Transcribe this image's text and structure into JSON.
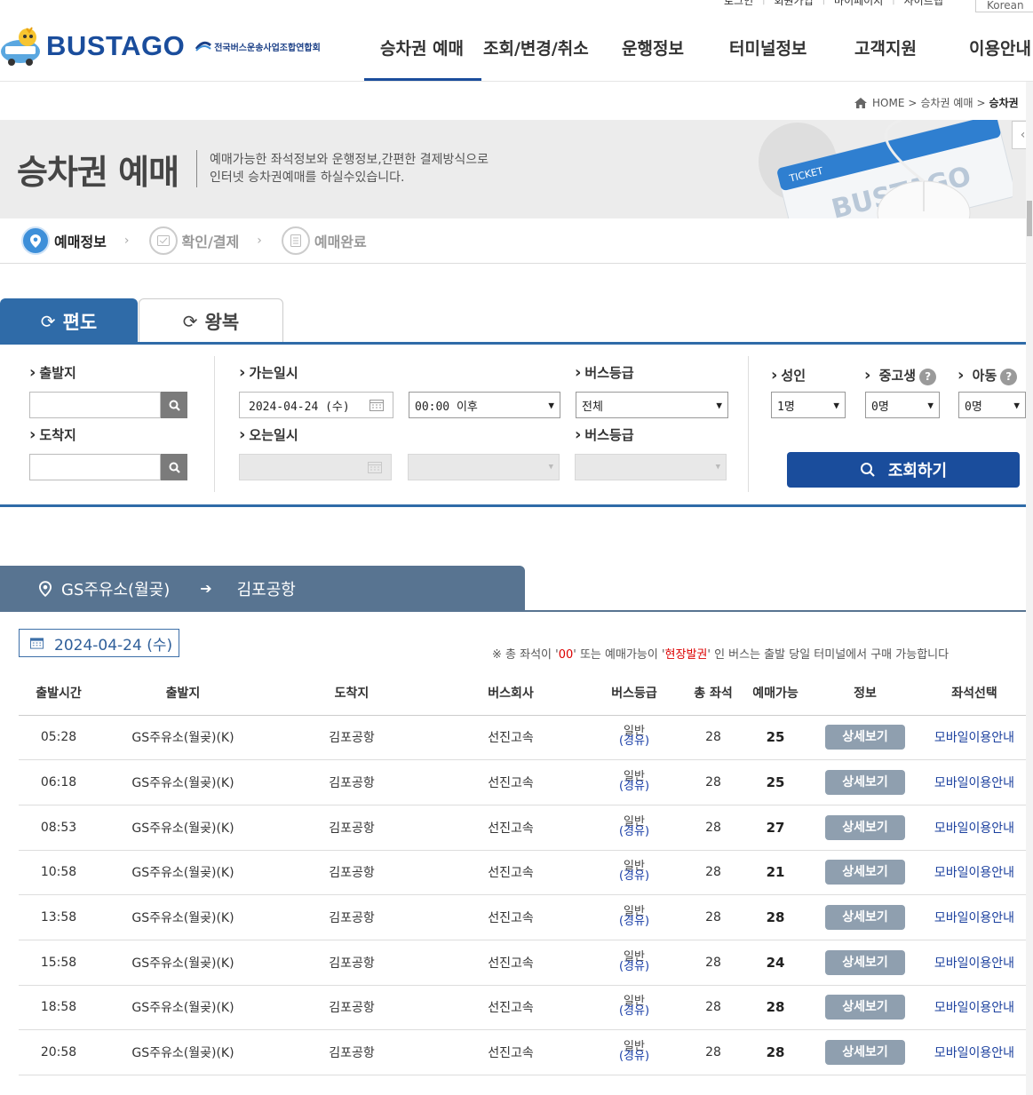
{
  "util": {
    "login": "로그인",
    "join": "회원가입",
    "mypage": "마이페이지",
    "sitemap": "사이트맵",
    "lang": "Korean"
  },
  "header": {
    "brand": "BUSTAGO",
    "assoc": "전국버스운송사업조합연합회",
    "nav": [
      "승차권 예매",
      "조회/변경/취소",
      "운행정보",
      "터미널정보",
      "고객지원",
      "이용안내"
    ]
  },
  "breadcrumb": {
    "home": "HOME",
    "section": "승차권 예매",
    "current": "승차권"
  },
  "banner": {
    "title": "승차권 예매",
    "desc1": "예매가능한 좌석정보와 운행정보,간편한 결제방식으로",
    "desc2": "인터넷 승차권예매를 하실수있습니다.",
    "ticket_label": "TICKET",
    "ticket_brand": "BUSTAGO"
  },
  "steps": [
    "예매정보",
    "확인/결제",
    "예매완료"
  ],
  "tabs": {
    "oneway": "편도",
    "round": "왕복"
  },
  "search": {
    "depart_label": "출발지",
    "arrive_label": "도착지",
    "go_date_label": "가는일시",
    "go_date": "2024-04-24 (수)",
    "go_time": "00:00 이후",
    "grade_label": "버스등급",
    "grade_value": "전체",
    "return_date_label": "오는일시",
    "return_grade_label": "버스등급",
    "adult_label": "성인",
    "adult_value": "1명",
    "teen_label": "중고생",
    "teen_value": "0명",
    "child_label": "아동",
    "child_value": "0명",
    "submit": "조회하기"
  },
  "route": {
    "from": "GS주유소(월곶)",
    "to": "김포공항"
  },
  "result_date": "2024-04-24 (수)",
  "notice": {
    "prefix": "※ 총 좌석이 '",
    "zero": "00",
    "mid": "' 또는 예매가능이 '",
    "onsite": "현장발권",
    "suffix": "' 인 버스는 출발 당일 터미널에서 구매 가능합니다"
  },
  "table": {
    "headers": [
      "출발시간",
      "출발지",
      "도착지",
      "버스회사",
      "버스등급",
      "총 좌석",
      "예매가능",
      "정보",
      "좌석선택"
    ],
    "rows": [
      {
        "time": "05:28",
        "from": "GS주유소(월곶)(K)",
        "to": "김포공항",
        "company": "선진고속",
        "grade": "일반",
        "grade_sub": "(경유)",
        "total": "28",
        "avail": "25",
        "detail": "상세보기",
        "seat": "모바일이용안내"
      },
      {
        "time": "06:18",
        "from": "GS주유소(월곶)(K)",
        "to": "김포공항",
        "company": "선진고속",
        "grade": "일반",
        "grade_sub": "(경유)",
        "total": "28",
        "avail": "25",
        "detail": "상세보기",
        "seat": "모바일이용안내"
      },
      {
        "time": "08:53",
        "from": "GS주유소(월곶)(K)",
        "to": "김포공항",
        "company": "선진고속",
        "grade": "일반",
        "grade_sub": "(경유)",
        "total": "28",
        "avail": "27",
        "detail": "상세보기",
        "seat": "모바일이용안내"
      },
      {
        "time": "10:58",
        "from": "GS주유소(월곶)(K)",
        "to": "김포공항",
        "company": "선진고속",
        "grade": "일반",
        "grade_sub": "(경유)",
        "total": "28",
        "avail": "21",
        "detail": "상세보기",
        "seat": "모바일이용안내"
      },
      {
        "time": "13:58",
        "from": "GS주유소(월곶)(K)",
        "to": "김포공항",
        "company": "선진고속",
        "grade": "일반",
        "grade_sub": "(경유)",
        "total": "28",
        "avail": "28",
        "detail": "상세보기",
        "seat": "모바일이용안내"
      },
      {
        "time": "15:58",
        "from": "GS주유소(월곶)(K)",
        "to": "김포공항",
        "company": "선진고속",
        "grade": "일반",
        "grade_sub": "(경유)",
        "total": "28",
        "avail": "24",
        "detail": "상세보기",
        "seat": "모바일이용안내"
      },
      {
        "time": "18:58",
        "from": "GS주유소(월곶)(K)",
        "to": "김포공항",
        "company": "선진고속",
        "grade": "일반",
        "grade_sub": "(경유)",
        "total": "28",
        "avail": "28",
        "detail": "상세보기",
        "seat": "모바일이용안내"
      },
      {
        "time": "20:58",
        "from": "GS주유소(월곶)(K)",
        "to": "김포공항",
        "company": "선진고속",
        "grade": "일반",
        "grade_sub": "(경유)",
        "total": "28",
        "avail": "28",
        "detail": "상세보기",
        "seat": "모바일이용안내"
      }
    ]
  },
  "colors": {
    "brand": "#1a4d9c",
    "tab_active": "#2f6ba8",
    "route_bar": "#587491",
    "detail_btn": "#8f9faf"
  }
}
